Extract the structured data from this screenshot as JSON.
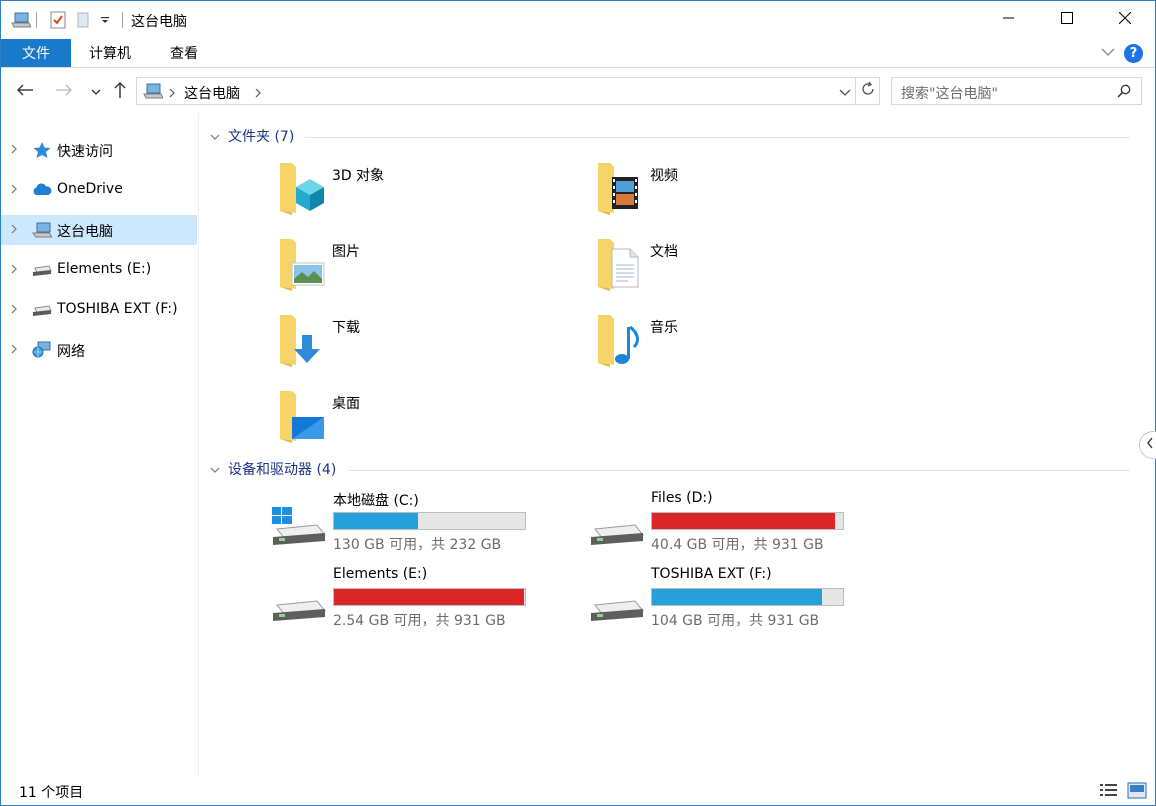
{
  "window": {
    "title": "这台电脑",
    "controls": {
      "minimize": "minimize-icon",
      "maximize": "maximize-icon",
      "close": "close-icon"
    }
  },
  "ribbon": {
    "tabs": [
      {
        "label": "文件",
        "active": true
      },
      {
        "label": "计算机",
        "active": false
      },
      {
        "label": "查看",
        "active": false
      }
    ],
    "help": "?"
  },
  "address": {
    "path": "这台电脑",
    "search_placeholder": "搜索\"这台电脑\""
  },
  "sidebar": {
    "items": [
      {
        "label": "快速访问",
        "icon": "star-icon",
        "selected": false
      },
      {
        "label": "OneDrive",
        "icon": "cloud-icon",
        "selected": false
      },
      {
        "label": "这台电脑",
        "icon": "computer-icon",
        "selected": true
      },
      {
        "label": "Elements (E:)",
        "icon": "drive-icon",
        "selected": false
      },
      {
        "label": "TOSHIBA EXT (F:)",
        "icon": "drive-icon",
        "selected": false
      },
      {
        "label": "网络",
        "icon": "network-icon",
        "selected": false
      }
    ]
  },
  "folders_group": {
    "header": "文件夹 (7)",
    "items": [
      {
        "name": "3D 对象",
        "icon": "3d-objects-folder-icon"
      },
      {
        "name": "视频",
        "icon": "videos-folder-icon"
      },
      {
        "name": "图片",
        "icon": "pictures-folder-icon"
      },
      {
        "name": "文档",
        "icon": "documents-folder-icon"
      },
      {
        "name": "下载",
        "icon": "downloads-folder-icon"
      },
      {
        "name": "音乐",
        "icon": "music-folder-icon"
      },
      {
        "name": "桌面",
        "icon": "desktop-folder-icon"
      }
    ]
  },
  "drives_group": {
    "header": "设备和驱动器 (4)",
    "items": [
      {
        "name": "本地磁盘 (C:)",
        "free_text": "130 GB 可用，共 232 GB",
        "used_fraction": 0.44,
        "bar_color": "#26a0da",
        "icon": "windows-drive-icon"
      },
      {
        "name": "Files (D:)",
        "free_text": "40.4 GB 可用，共 931 GB",
        "used_fraction": 0.957,
        "bar_color": "#da2626",
        "icon": "hard-drive-icon"
      },
      {
        "name": "Elements (E:)",
        "free_text": "2.54 GB 可用，共 931 GB",
        "used_fraction": 0.997,
        "bar_color": "#da2626",
        "icon": "hard-drive-icon"
      },
      {
        "name": "TOSHIBA EXT (F:)",
        "free_text": "104 GB 可用，共 931 GB",
        "used_fraction": 0.888,
        "bar_color": "#26a0da",
        "icon": "hard-drive-icon"
      }
    ]
  },
  "status": {
    "count": "11 个项目"
  }
}
